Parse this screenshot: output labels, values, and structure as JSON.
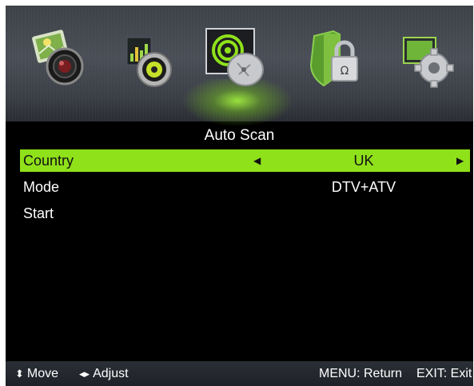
{
  "menu_icons": [
    {
      "name": "picture-icon"
    },
    {
      "name": "sound-icon"
    },
    {
      "name": "channel-icon",
      "selected": true
    },
    {
      "name": "lock-icon"
    },
    {
      "name": "setup-icon"
    }
  ],
  "title": "Auto Scan",
  "rows": [
    {
      "label": "Country",
      "value": "UK",
      "active": true
    },
    {
      "label": "Mode",
      "value": "DTV+ATV"
    },
    {
      "label": "Start",
      "value": ""
    }
  ],
  "hints": {
    "move_glyph": "⬍",
    "move": "Move",
    "adjust_glyph": "◂▸",
    "adjust": "Adjust",
    "menu": "MENU: Return",
    "exit": "EXIT: Exit"
  },
  "colors": {
    "highlight": "#8fe11a",
    "background": "#000000"
  }
}
